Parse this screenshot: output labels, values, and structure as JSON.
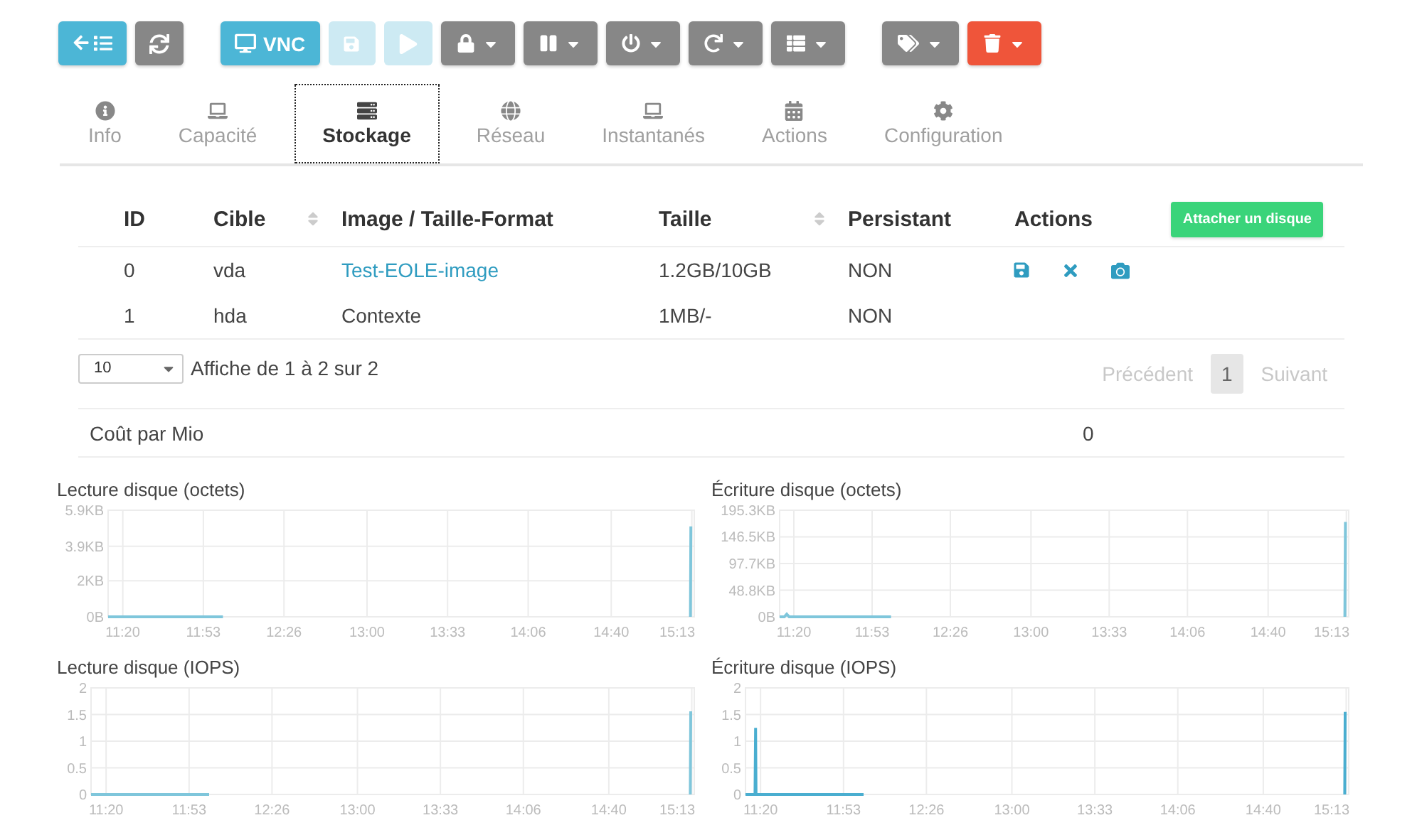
{
  "toolbar": {
    "groups": [
      {
        "buttons": [
          {
            "kind": "primary",
            "disabled": false,
            "dropdown": false
          },
          {
            "kind": "default",
            "disabled": false,
            "dropdown": false
          }
        ]
      },
      {
        "buttons": [
          {
            "kind": "primary",
            "disabled": false,
            "dropdown": false,
            "label": "VNC"
          },
          {
            "kind": "primary",
            "disabled": true,
            "dropdown": false
          },
          {
            "kind": "primary",
            "disabled": true,
            "dropdown": false
          },
          {
            "kind": "default",
            "disabled": false,
            "dropdown": true
          },
          {
            "kind": "default",
            "disabled": false,
            "dropdown": true
          },
          {
            "kind": "default",
            "disabled": false,
            "dropdown": true
          },
          {
            "kind": "default",
            "disabled": false,
            "dropdown": true
          },
          {
            "kind": "default",
            "disabled": false,
            "dropdown": true
          }
        ]
      },
      {
        "buttons": [
          {
            "kind": "default",
            "disabled": false,
            "dropdown": true
          },
          {
            "kind": "danger",
            "disabled": false,
            "dropdown": true
          }
        ]
      }
    ]
  },
  "tabs": [
    {
      "label": "Info",
      "selected": false
    },
    {
      "label": "Capacité",
      "selected": false
    },
    {
      "label": "Stockage",
      "selected": true
    },
    {
      "label": "Réseau",
      "selected": false
    },
    {
      "label": "Instantanés",
      "selected": false
    },
    {
      "label": "Actions",
      "selected": false
    },
    {
      "label": "Configuration",
      "selected": false
    }
  ],
  "table": {
    "columns": [
      {
        "label": "ID",
        "sortable": false
      },
      {
        "label": "Cible",
        "sortable": true
      },
      {
        "label": "Image / Taille-Format",
        "sortable": false
      },
      {
        "label": "Taille",
        "sortable": true
      },
      {
        "label": "Persistant",
        "sortable": false
      },
      {
        "label": "Actions",
        "sortable": false
      }
    ],
    "attach_button": "Attacher un disque",
    "rows": [
      {
        "cells": [
          "0",
          "vda",
          "Test-EOLE-image",
          "1.2GB/10GB",
          "NON"
        ],
        "image_link": true,
        "actions": true
      },
      {
        "cells": [
          "1",
          "hda",
          "Contexte",
          "1MB/-",
          "NON"
        ],
        "image_link": false,
        "actions": false
      }
    ]
  },
  "pagination": {
    "page_size": "10",
    "info": "Affiche de 1 à 2 sur 2",
    "previous": {
      "label": "Précédent",
      "disabled": true
    },
    "pages": [
      {
        "label": "1",
        "selected": true
      }
    ],
    "next": {
      "label": "Suivant",
      "disabled": true
    }
  },
  "cost": {
    "label": "Coût par Mio",
    "value": "0"
  },
  "charts": [
    {
      "chart_data": {
        "type": "line",
        "title": "Lecture disque (octets)",
        "grid": true,
        "x": [
          674,
          721,
          722,
          912.4,
          912.6
        ],
        "series": [
          {
            "color": "#7fc6db",
            "values": [
              0,
              0,
              null,
              0,
              5
            ]
          }
        ],
        "xlim": [
          674,
          914
        ],
        "ylim": [
          0,
          5.9
        ],
        "xticks": [
          {
            "value": 680,
            "label": "11:20"
          },
          {
            "value": 713,
            "label": "11:53"
          },
          {
            "value": 746,
            "label": "12:26"
          },
          {
            "value": 780,
            "label": "13:00"
          },
          {
            "value": 813,
            "label": "13:33"
          },
          {
            "value": 846,
            "label": "14:06"
          },
          {
            "value": 880,
            "label": "14:40"
          },
          {
            "value": 913,
            "label": "15:13"
          }
        ],
        "yticks": [
          {
            "value": 0,
            "label": "0B"
          },
          {
            "value": 2,
            "label": "2KB"
          },
          {
            "value": 3.9,
            "label": "3.9KB"
          },
          {
            "value": 5.9,
            "label": "5.9KB"
          }
        ]
      }
    },
    {
      "chart_data": {
        "type": "line",
        "title": "Écriture disque (octets)",
        "grid": true,
        "x": [
          674,
          676,
          677,
          678,
          721,
          722,
          912.4,
          912.6
        ],
        "series": [
          {
            "color": "#7fc6db",
            "values": [
              0,
              0,
              5,
              0,
              0,
              null,
              0,
              174
            ]
          }
        ],
        "xlim": [
          674,
          914
        ],
        "ylim": [
          0,
          195.3
        ],
        "xticks": [
          {
            "value": 680,
            "label": "11:20"
          },
          {
            "value": 713,
            "label": "11:53"
          },
          {
            "value": 746,
            "label": "12:26"
          },
          {
            "value": 780,
            "label": "13:00"
          },
          {
            "value": 813,
            "label": "13:33"
          },
          {
            "value": 846,
            "label": "14:06"
          },
          {
            "value": 880,
            "label": "14:40"
          },
          {
            "value": 913,
            "label": "15:13"
          }
        ],
        "yticks": [
          {
            "value": 0,
            "label": "0B"
          },
          {
            "value": 48.8,
            "label": "48.8KB"
          },
          {
            "value": 97.7,
            "label": "97.7KB"
          },
          {
            "value": 146.5,
            "label": "146.5KB"
          },
          {
            "value": 195.3,
            "label": "195.3KB"
          }
        ]
      }
    },
    {
      "chart_data": {
        "type": "line",
        "title": "Lecture disque (IOPS)",
        "grid": true,
        "x": [
          674,
          721,
          722,
          912.4,
          912.6
        ],
        "series": [
          {
            "color": "#7fc6db",
            "values": [
              0,
              0,
              null,
              0,
              1.56
            ]
          }
        ],
        "xlim": [
          674,
          914
        ],
        "ylim": [
          0,
          2
        ],
        "xticks": [
          {
            "value": 680,
            "label": "11:20"
          },
          {
            "value": 713,
            "label": "11:53"
          },
          {
            "value": 746,
            "label": "12:26"
          },
          {
            "value": 780,
            "label": "13:00"
          },
          {
            "value": 813,
            "label": "13:33"
          },
          {
            "value": 846,
            "label": "14:06"
          },
          {
            "value": 880,
            "label": "14:40"
          },
          {
            "value": 913,
            "label": "15:13"
          }
        ],
        "yticks": [
          0,
          0.5,
          1,
          1.5,
          2
        ]
      }
    },
    {
      "chart_data": {
        "type": "line",
        "title": "Écriture disque (IOPS)",
        "grid": true,
        "x": [
          674,
          677.8,
          678,
          678.2,
          721,
          722,
          912.4,
          912.6
        ],
        "series": [
          {
            "color": "#4aaed0",
            "values": [
              0,
              0,
              1.25,
              0,
              0,
              null,
              0,
              1.55
            ]
          }
        ],
        "xlim": [
          674,
          914
        ],
        "ylim": [
          0,
          2
        ],
        "xticks": [
          {
            "value": 680,
            "label": "11:20"
          },
          {
            "value": 713,
            "label": "11:53"
          },
          {
            "value": 746,
            "label": "12:26"
          },
          {
            "value": 780,
            "label": "13:00"
          },
          {
            "value": 813,
            "label": "13:33"
          },
          {
            "value": 846,
            "label": "14:06"
          },
          {
            "value": 880,
            "label": "14:40"
          },
          {
            "value": 913,
            "label": "15:13"
          }
        ],
        "yticks": [
          0,
          0.5,
          1,
          1.5,
          2
        ]
      }
    }
  ]
}
